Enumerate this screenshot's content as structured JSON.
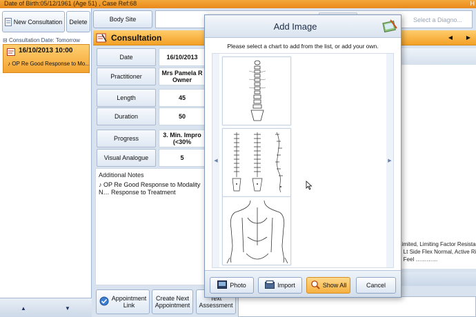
{
  "window": {
    "patient_info": "Date of Birth:05/12/1961 (Age 51) , Case Ref:68",
    "corner_char": "H"
  },
  "left": {
    "new_consultation": "New Consultation",
    "delete": "Delete",
    "consultation_date_label": "Consultation Date: Tomorrow",
    "item_date": "16/10/2013 10:00",
    "item_summary": "OP Re Good Response to Mo..."
  },
  "top": {
    "body_site": "Body Site",
    "diagnosis_placeholder": "Select a Diagno..."
  },
  "consultation": {
    "header": "Consultation",
    "fields": {
      "date_label": "Date",
      "date_value": "16/10/2013",
      "practitioner_label": "Practitioner",
      "practitioner_value_1": "Mrs Pamela R",
      "practitioner_value_2": "Owner",
      "length_label": "Length",
      "length_value": "45",
      "duration_label": "Duration",
      "duration_value": "50",
      "progress_label": "Progress",
      "progress_value_1": "3. Min. Impro",
      "progress_value_2": "(<30%",
      "visual_analogue_label": "Visual Analogue",
      "visual_analogue_value": "5"
    },
    "additional_notes_label": "Additional Notes",
    "notes_text": "OP Re Good Response to Modality  N… Response to Treatment",
    "right_text_lines": [
      "Limited, Limiting Factor Resistanc",
      "e Lt Side Flex Normal, Active Righ",
      "d Feel …………"
    ]
  },
  "footer": {
    "appointment_link_1": "Appointment",
    "appointment_link_2": "Link",
    "create_next_1": "Create Next",
    "create_next_2": "Appointment",
    "text_assessment_1": "Text",
    "text_assessment_2": "Assessment"
  },
  "dialog": {
    "title": "Add Image",
    "instruction": "Please select a chart to add from the list, or add your own.",
    "charts": [
      "spine-posterior-chart",
      "spine-views-chart",
      "upper-back-body-chart"
    ],
    "buttons": {
      "photo": "Photo",
      "import": "Import",
      "show_all": "Show All",
      "cancel": "Cancel"
    }
  },
  "colors": {
    "accent_orange": "#f3a126",
    "panel_blue": "#d9e3ef",
    "border_blue": "#9eb1cc"
  }
}
